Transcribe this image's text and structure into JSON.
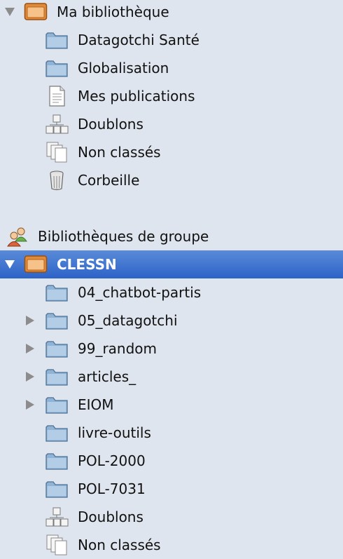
{
  "my_library": {
    "label": "Ma bibliothèque",
    "items": [
      {
        "label": "Datagotchi Santé",
        "icon": "folder-icon"
      },
      {
        "label": "Globalisation",
        "icon": "folder-icon"
      },
      {
        "label": "Mes publications",
        "icon": "document-icon"
      },
      {
        "label": "Doublons",
        "icon": "duplicates-icon"
      },
      {
        "label": "Non classés",
        "icon": "unfiled-icon"
      },
      {
        "label": "Corbeille",
        "icon": "trash-icon"
      }
    ]
  },
  "group_libraries": {
    "header_label": "Bibliothèques de groupe",
    "selected_group": {
      "label": "CLESSN",
      "items": [
        {
          "label": "04_chatbot-partis",
          "icon": "folder-icon"
        },
        {
          "label": "05_datagotchi",
          "icon": "folder-icon"
        },
        {
          "label": "99_random",
          "icon": "folder-icon"
        },
        {
          "label": "articles_",
          "icon": "folder-icon"
        },
        {
          "label": "EIOM",
          "icon": "folder-icon"
        },
        {
          "label": "livre-outils",
          "icon": "folder-icon"
        },
        {
          "label": "POL-2000",
          "icon": "folder-icon"
        },
        {
          "label": "POL-7031",
          "icon": "folder-icon"
        },
        {
          "label": "Doublons",
          "icon": "duplicates-icon"
        },
        {
          "label": "Non classés",
          "icon": "unfiled-icon"
        }
      ]
    }
  },
  "colors": {
    "sidebar_bg": "#dfe5ee",
    "selection_top": "#5a8ad8",
    "selection_bottom": "#2c63c8",
    "folder_blue": "#8fb3d6",
    "library_orange": "#e08a3c"
  }
}
